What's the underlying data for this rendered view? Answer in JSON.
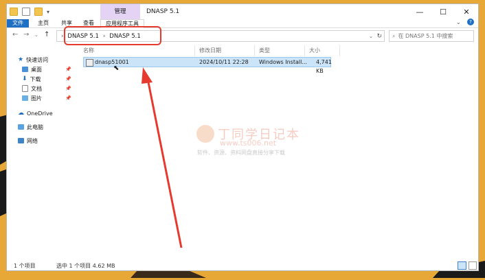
{
  "titlebar": {
    "context_tab": "管理",
    "title": "DNASP 5.1"
  },
  "ribbon": {
    "tabs": [
      "文件",
      "主页",
      "共享",
      "查看",
      "应用程序工具"
    ]
  },
  "address": {
    "crumbs": [
      "DNASP 5.1",
      "DNASP 5.1"
    ],
    "search_placeholder": "在 DNASP 5.1 中搜索"
  },
  "nav": {
    "quick_access": "快速访问",
    "items": [
      "桌面",
      "下载",
      "文档",
      "图片"
    ],
    "onedrive": "OneDrive",
    "this_pc": "此电脑",
    "network": "网络"
  },
  "columns": [
    "名称",
    "修改日期",
    "类型",
    "大小"
  ],
  "files": [
    {
      "name": "dnasp51001",
      "date": "2024/10/11 22:28",
      "type": "Windows Install...",
      "size": "4,741 KB"
    }
  ],
  "status": {
    "count": "1 个项目",
    "selected": "选中 1 个项目  4.62 MB"
  },
  "watermark": {
    "brand": "丁同学日记本",
    "url": "www.ts006.net",
    "tagline": "软件、资源、资料网盘直接分享下载"
  },
  "colors": {
    "annotation_red": "#e63a2e",
    "accent": "#1f6fc4",
    "selection": "#cce4f7"
  }
}
